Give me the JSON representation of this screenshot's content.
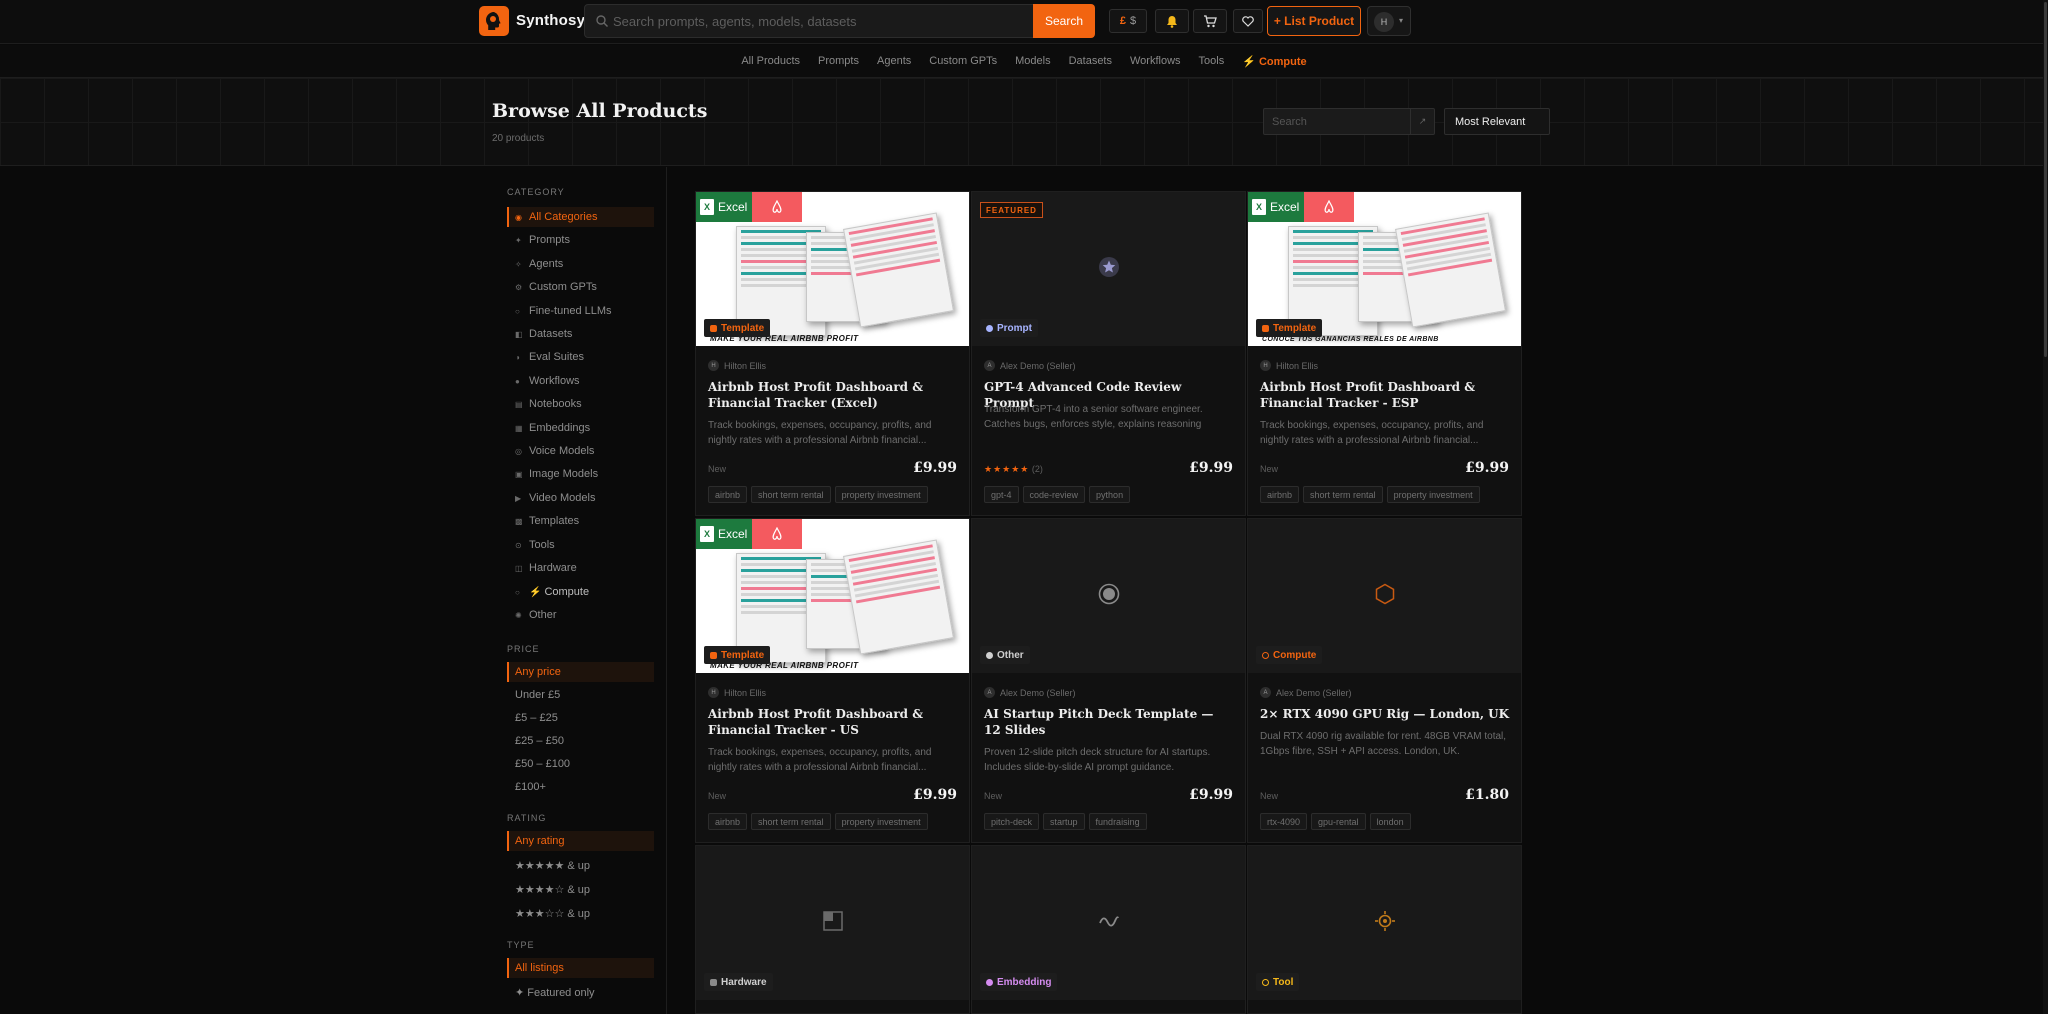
{
  "header": {
    "brand": "Synthosy",
    "search_placeholder": "Search prompts, agents, models, datasets",
    "search_button": "Search",
    "currency_selected": "£",
    "currency_alt": "$",
    "list_product": "+ List Product",
    "avatar_initial": "H"
  },
  "nav": {
    "items": [
      "All Products",
      "Prompts",
      "Agents",
      "Custom GPTs",
      "Models",
      "Datasets",
      "Workflows",
      "Tools"
    ],
    "compute": "Compute"
  },
  "hero": {
    "title": "Browse All Products",
    "count": "20 products",
    "search_placeholder": "Search",
    "sort": "Most Relevant"
  },
  "sidebar": {
    "category_title": "CATEGORY",
    "categories": [
      "All Categories",
      "Prompts",
      "Agents",
      "Custom GPTs",
      "Fine-tuned LLMs",
      "Datasets",
      "Eval Suites",
      "Workflows",
      "Notebooks",
      "Embeddings",
      "Voice Models",
      "Image Models",
      "Video Models",
      "Templates",
      "Tools",
      "Hardware",
      "Compute",
      "Other"
    ],
    "price_title": "PRICE",
    "prices": [
      "Any price",
      "Under £5",
      "£5 – £25",
      "£25 – £50",
      "£50 – £100",
      "£100+"
    ],
    "rating_title": "RATING",
    "ratings": [
      "Any rating",
      "★★★★★ & up",
      "★★★★☆ & up",
      "★★★☆☆ & up"
    ],
    "type_title": "TYPE",
    "types": [
      "All listings",
      "✦ Featured only"
    ]
  },
  "cards": [
    {
      "badge": "Template",
      "seller": "Hilton Ellis",
      "seller_initial": "H",
      "art_caption": "MAKE YOUR REAL AIRBNB PROFIT",
      "art_label": "Excel",
      "title": "Airbnb Host Profit Dashboard & Financial Tracker (Excel)",
      "desc": "Track bookings, expenses, occupancy, profits, and nightly rates with a professional Airbnb financial...",
      "status": "New",
      "price": "£9.99",
      "tags": [
        "airbnb",
        "short term rental",
        "property investment"
      ]
    },
    {
      "badge": "Prompt",
      "featured": "FEATURED",
      "seller": "Alex Demo (Seller)",
      "seller_initial": "A",
      "title": "GPT-4 Advanced Code Review Prompt",
      "desc": "Transform GPT-4 into a senior software engineer. Catches bugs, enforces style, explains reasoning",
      "stars": "★★★★★",
      "rating_count": "(2)",
      "price": "£9.99",
      "tags": [
        "gpt-4",
        "code-review",
        "python"
      ]
    },
    {
      "badge": "Template",
      "seller": "Hilton Ellis",
      "seller_initial": "H",
      "art_caption": "CONOCE TUS GANANCIAS REALES DE AIRBNB",
      "art_label": "Excel",
      "title": "Airbnb Host Profit Dashboard & Financial Tracker - ESP",
      "desc": "Track bookings, expenses, occupancy, profits, and nightly rates with a professional Airbnb financial...",
      "status": "New",
      "price": "£9.99",
      "tags": [
        "airbnb",
        "short term rental",
        "property investment"
      ]
    },
    {
      "badge": "Template",
      "seller": "Hilton Ellis",
      "seller_initial": "H",
      "art_caption": "MAKE YOUR REAL AIRBNB PROFIT",
      "art_label": "Excel",
      "title": "Airbnb Host Profit Dashboard & Financial Tracker - US",
      "desc": "Track bookings, expenses, occupancy, profits, and nightly rates with a professional Airbnb financial...",
      "status": "New",
      "price": "£9.99",
      "tags": [
        "airbnb",
        "short term rental",
        "property investment"
      ]
    },
    {
      "badge": "Other",
      "seller": "Alex Demo (Seller)",
      "seller_initial": "A",
      "title": "AI Startup Pitch Deck Template — 12 Slides",
      "desc": "Proven 12-slide pitch deck structure for AI startups. Includes slide-by-slide AI prompt guidance.",
      "status": "New",
      "price": "£9.99",
      "tags": [
        "pitch-deck",
        "startup",
        "fundraising"
      ]
    },
    {
      "badge": "Compute",
      "seller": "Alex Demo (Seller)",
      "seller_initial": "A",
      "title": "2× RTX 4090 GPU Rig — London, UK",
      "desc": "Dual RTX 4090 rig available for rent. 48GB VRAM total, 1Gbps fibre, SSH + API access. London, UK.",
      "status": "New",
      "price": "£1.80",
      "tags": [
        "rtx-4090",
        "gpu-rental",
        "london"
      ]
    },
    {
      "badge": "Hardware"
    },
    {
      "badge": "Embedding"
    },
    {
      "badge": "Tool"
    }
  ],
  "colors": {
    "accent": "#f26410",
    "background": "#0a0a0a",
    "card": "#111111"
  }
}
